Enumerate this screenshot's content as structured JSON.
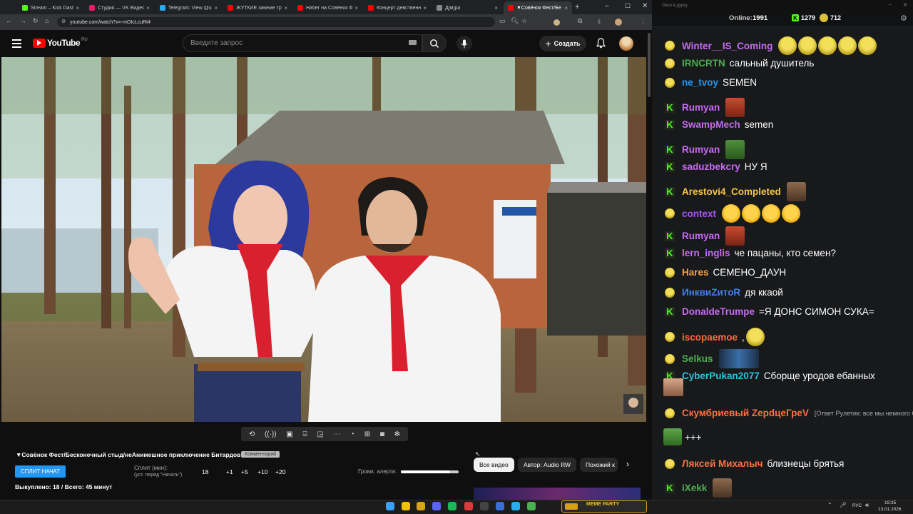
{
  "browser": {
    "tabs": [
      {
        "label": "Stream – Kick Dashboard",
        "color": "#53fc18"
      },
      {
        "label": "Студия — VK Видео Live",
        "color": "#e91e63"
      },
      {
        "label": "Telegram: View @union",
        "color": "#2aabee"
      },
      {
        "label": "ЖУТКИЕ зимние тренды",
        "color": "#ff0000"
      },
      {
        "label": "Набег на Совёнок Фест",
        "color": "#ff0000"
      },
      {
        "label": "Концерт девственник",
        "color": "#ff0000"
      },
      {
        "label": "Д[м]ра",
        "color": "#888888"
      },
      {
        "label": "▼Совёнок Фест/Бе",
        "color": "#ff0000"
      }
    ],
    "new_tab": "+",
    "url": "youtube.com/watch?v=-mOIcLcuRt4"
  },
  "youtube": {
    "logo_text": "YouTube",
    "logo_region": "RU",
    "search_placeholder": "Введите запрос",
    "create_label": "Создать"
  },
  "player": {
    "title": "▼Совёнок Фест/Бесконечный стыд/неАнимешное приключение Битардов",
    "title_badge": "Комментарий",
    "split_button": "СПЛИТ НАЧАТ",
    "split_label": "Сплит (мин):",
    "split_hint": "(уст. перед \"Начать\")",
    "split_value": "18",
    "increments": [
      "+1",
      "+5",
      "+10",
      "+20"
    ],
    "alert_label": "Громк. алерта:",
    "alert_level": 0.85,
    "progress_text": "Выкуплено: 18 / Всего: 45 минут",
    "chips": [
      "Все видео",
      "Автор: Audio RW",
      "Похожий к"
    ]
  },
  "chat": {
    "window_title": "Окно в дурку",
    "online_label": "Online:",
    "online_value": "1991",
    "kick_count": "1279",
    "coins_count": "712",
    "messages": [
      {
        "badge": "pepe",
        "user": "Winter__IS_Coming",
        "color": "#c56cf0",
        "text": "",
        "emotes": "pepe5"
      },
      {
        "badge": "pepe",
        "user": "IRNCRTN",
        "color": "#4caf50",
        "text": "сальный душитель"
      },
      {
        "badge": "pepe",
        "user": "ne_tvoy",
        "color": "#2196f3",
        "text": "SEMEN"
      },
      {
        "badge": "kick",
        "user": "Rumyan",
        "color": "#c56cf0",
        "text": "",
        "emotes": "face-red"
      },
      {
        "badge": "kick",
        "user": "SwampMech",
        "color": "#c56cf0",
        "text": "semen"
      },
      {
        "badge": "kick",
        "user": "Rumyan",
        "color": "#c56cf0",
        "text": "",
        "emotes": "frog"
      },
      {
        "badge": "kick",
        "user": "saduzbekcry",
        "color": "#c56cf0",
        "text": "НУ Я"
      },
      {
        "badge": "kick",
        "user": "Arestovi4_Completed",
        "color": "#f5c542",
        "text": "",
        "emotes": "face-man"
      },
      {
        "badge": "pepe",
        "user": "context",
        "color": "#a855f7",
        "text": "",
        "emotes": "cry4"
      },
      {
        "badge": "kick",
        "user": "Rumyan",
        "color": "#c56cf0",
        "text": "",
        "emotes": "face-red"
      },
      {
        "badge": "kick",
        "user": "lern_inglis",
        "color": "#c56cf0",
        "text": "че пацаны, кто семен?"
      },
      {
        "badge": "pepe",
        "user": "Hares",
        "color": "#f5a142",
        "text": "СЕМЕНО_ДАУН"
      },
      {
        "badge": "pepe",
        "user": "ИнквиZитоR",
        "color": "#3f7ff5",
        "text": "дя ккаой"
      },
      {
        "badge": "kick",
        "user": "DonaldeTrumpe",
        "color": "#c56cf0",
        "text": "=Я ДОНС СИМОН СУКА="
      },
      {
        "badge": "pepe",
        "user": "iscopaemoe",
        "color": "#ff6a3d",
        "text": ",",
        "emotes": "pepe1"
      },
      {
        "badge": "pepe",
        "user": "Selkus",
        "color": "#4caf50",
        "text": "",
        "emotes": "blue"
      },
      {
        "badge": "kick",
        "user": "CyberPukan2077",
        "color": "#26c6da",
        "text": "Сборще уродов ебанных",
        "emotes": "face-small"
      },
      {
        "badge": "pepe",
        "user": "Скумбриевый ZерdцеГреV",
        "color": "#ff7043",
        "text": "",
        "reply": "[Ответ Рулетик: все мы немного Сэмен)))]",
        "extra": "+++"
      },
      {
        "badge": "pepe",
        "user": "Ляксей Михалыч",
        "color": "#ff7043",
        "text": "близнецы брятья"
      },
      {
        "badge": "kick",
        "user": "iXekk",
        "color": "#4caf50",
        "text": "",
        "emotes": "face-man"
      }
    ]
  },
  "taskbar": {
    "media": "MEME PARTY",
    "lang": "РУС",
    "time": "19:35",
    "date": "13.01.2026"
  }
}
